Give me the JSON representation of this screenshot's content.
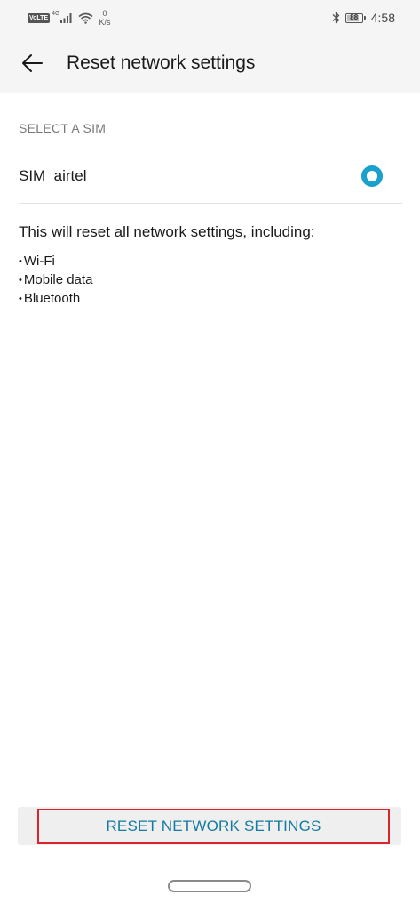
{
  "status_bar": {
    "volte": "VoLTE",
    "network_type": "4G",
    "speed_value": "0",
    "speed_unit": "K/s",
    "battery_percent": "88",
    "battery_level": 0.88,
    "time": "4:58",
    "icons": [
      "signal-icon",
      "wifi-icon",
      "bluetooth-icon",
      "battery-icon"
    ]
  },
  "app_bar": {
    "back_icon": "arrow-left-icon",
    "title": "Reset network settings"
  },
  "sim_section": {
    "header": "SELECT A SIM",
    "sim_label": "SIM  airtel",
    "selected": true,
    "accent_color": "#1a9fcf"
  },
  "description": "This will reset all network settings, including:",
  "items": [
    "Wi-Fi",
    "Mobile data",
    "Bluetooth"
  ],
  "button": {
    "label": "RESET NETWORK SETTINGS",
    "text_color": "#137aa0",
    "highlight_color": "#d9262e"
  }
}
